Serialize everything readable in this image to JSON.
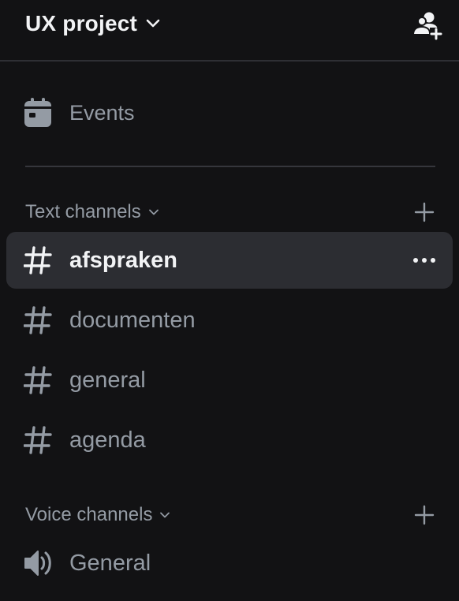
{
  "server": {
    "name": "UX project"
  },
  "events": {
    "label": "Events"
  },
  "text_category": {
    "label": "Text channels"
  },
  "text_channels": [
    {
      "name": "afspraken",
      "selected": true
    },
    {
      "name": "documenten",
      "selected": false
    },
    {
      "name": "general",
      "selected": false
    },
    {
      "name": "agenda",
      "selected": false
    }
  ],
  "voice_category": {
    "label": "Voice channels"
  },
  "voice_channels": [
    {
      "name": "General"
    }
  ],
  "colors": {
    "background": "#121214",
    "selected_row": "#2c2d32",
    "muted_text": "#949ba4",
    "bright_text": "#f2f3f5",
    "divider": "#35363c"
  },
  "icons": {
    "server_menu": "chevron-down-icon",
    "invite": "add-member-icon",
    "events": "calendar-icon",
    "category_collapse": "chevron-down-icon",
    "category_add": "plus-icon",
    "text_channel": "hash-icon",
    "voice_channel": "speaker-icon",
    "channel_more": "ellipsis-icon"
  }
}
